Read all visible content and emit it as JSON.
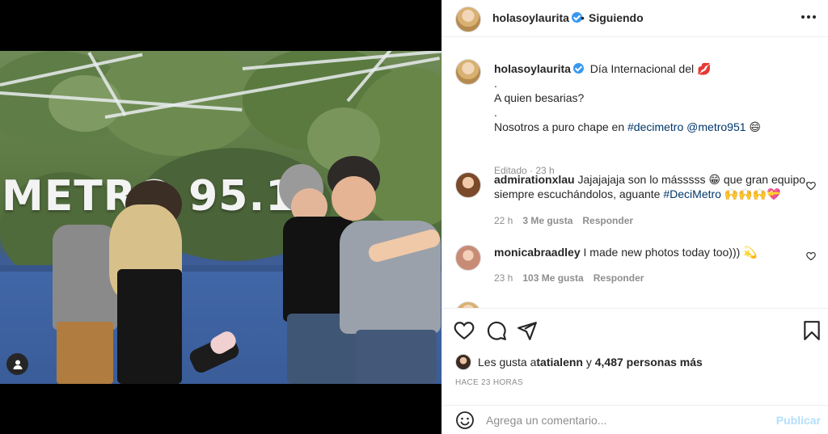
{
  "header": {
    "username": "holasoylaurita",
    "separator": "•",
    "follow_label": "Siguiendo",
    "more_icon": "more-options-icon"
  },
  "media": {
    "sign_text": "METRO 95.1",
    "tag_icon": "user-tag-icon"
  },
  "caption": {
    "username": "holasoylaurita",
    "line1": "Día Internacional del 💋",
    "line2": ".",
    "line3": "A quien besarias?",
    "line4": ".",
    "line5_prefix": "Nosotros a puro chape en ",
    "hashtag": "#decimetro",
    "mention": "@metro951",
    "emoji": "😄",
    "edited": "Editado",
    "time": "23 h"
  },
  "comments": [
    {
      "username": "admirationxlau",
      "text_a": "Jajajajaja son lo másssss 😁 que gran equipo,",
      "text_b": "siempre escuchándolos, aguante ",
      "hashtag": "#DeciMetro",
      "emoji_tail": " 🙌🙌🙌💝",
      "time": "22 h",
      "likes": "3 Me gusta",
      "reply": "Responder"
    },
    {
      "username": "monicabraadley",
      "text_a": "I made new photos today too))) 💫",
      "time": "23 h",
      "likes": "103 Me gusta",
      "reply": "Responder"
    }
  ],
  "actions": {
    "icons": [
      "heart-icon",
      "comment-icon",
      "share-icon",
      "bookmark-icon"
    ],
    "liked_prefix": "Les gusta a ",
    "liked_user": "tatialenn",
    "liked_mid": " y ",
    "liked_count": "4,487 personas más",
    "time_ago": "HACE 23 HORAS"
  },
  "composer": {
    "placeholder": "Agrega un comentario...",
    "publish_label": "Publicar"
  },
  "colors": {
    "link": "#00376b",
    "verified": "#3897f0",
    "muted": "#8e8e8e",
    "publish_disabled": "#b2dffc"
  }
}
